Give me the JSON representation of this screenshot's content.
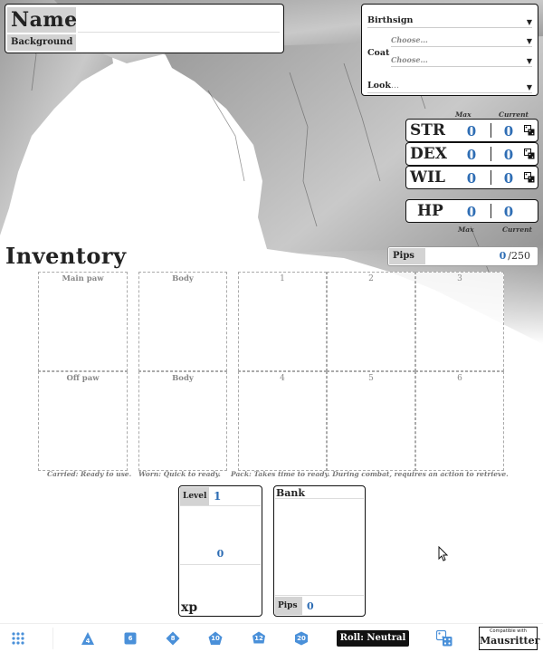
{
  "character": {
    "name_label": "Name",
    "name_value": "",
    "background_label": "Background",
    "background_value": ""
  },
  "identity": {
    "birthsign_label": "Birthsign",
    "birthsign_value": "",
    "coat_label": "Coat",
    "coat_color_placeholder": "Choose...",
    "coat_pattern_placeholder": "Choose...",
    "look_label": "Look",
    "look_placeholder": "..."
  },
  "stats": {
    "max_header": "Max",
    "current_header": "Current",
    "str": {
      "label": "STR",
      "max": "0",
      "current": "0"
    },
    "dex": {
      "label": "DEX",
      "max": "0",
      "current": "0"
    },
    "wil": {
      "label": "WIL",
      "max": "0",
      "current": "0"
    },
    "hp": {
      "label": "HP",
      "max": "0",
      "current": "0"
    }
  },
  "pips": {
    "label": "Pips",
    "value": "0",
    "max": "/250"
  },
  "inventory": {
    "title": "Inventory",
    "main_paw": "Main paw",
    "off_paw": "Off paw",
    "body_top": "Body",
    "body_bottom": "Body",
    "pack_slots": [
      "1",
      "2",
      "3",
      "4",
      "5",
      "6"
    ],
    "caption_carried": "Carried: Ready to use.",
    "caption_worn": "Worn: Quick to ready.",
    "caption_pack": "Pack: Takes time to ready. During combat, requires an action to retrieve."
  },
  "level": {
    "label": "Level",
    "value": "1",
    "xp_value": "0",
    "xp_label": "xp"
  },
  "bank": {
    "label": "Bank",
    "pips_label": "Pips",
    "pips_value": "0"
  },
  "toolbar": {
    "dice": [
      "4",
      "6",
      "8",
      "10",
      "12",
      "20"
    ],
    "roll_label": "Roll: Neutral",
    "compat_small": "Compatible with",
    "compat_big": "Mausritter"
  },
  "colors": {
    "accent_blue": "#2e6db4",
    "label_gray": "#d3d3d3",
    "dice_blue": "#4a90d9"
  }
}
